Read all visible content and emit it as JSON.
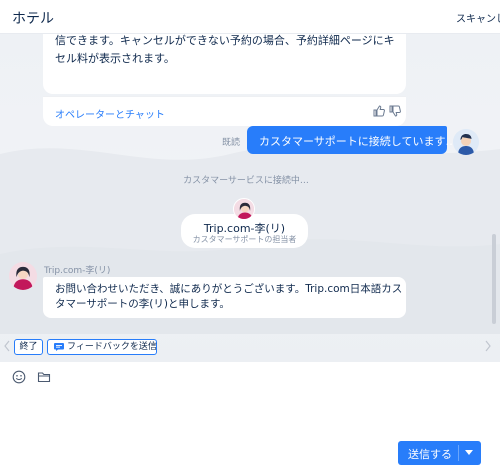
{
  "header": {
    "title": "ホテル",
    "right_text": "スキャンし"
  },
  "messages": {
    "previous": {
      "line1": "信できます。キャンセルができない予約の場合、予約詳細ページにキャン",
      "line2": "セル料が表示されます。",
      "operator_link": "オペレーターとチャット"
    },
    "user": {
      "read_label": "既読",
      "text": "カスタマーサポートに接続しています…"
    },
    "system": {
      "text": "カスタマーサービスに接続中…"
    },
    "agent_card": {
      "name": "Trip.com-李(リ)",
      "role": "カスタマーサポートの担当者"
    },
    "agent_reply": {
      "sender": "Trip.com-李(リ)",
      "line1": "お問い合わせいただき、誠にありがとうございます。Trip.com日本語カス",
      "line2": "タマーサポートの李(リ)と申します。"
    }
  },
  "actions": {
    "end_label": "終了",
    "feedback_label": "フィードバックを送信"
  },
  "composer": {
    "input_value": "",
    "input_placeholder": "",
    "send_label": "送信する"
  },
  "icons": {
    "like": "thumbs-up-icon",
    "dislike": "thumbs-down-icon",
    "emoji": "emoji-icon",
    "folder": "folder-icon",
    "feedback": "feedback-icon",
    "chevron_left": "chevron-left-icon",
    "chevron_right": "chevron-right-icon",
    "send_dropdown": "caret-down-icon"
  },
  "colors": {
    "accent": "#287dfa",
    "text": "#0f294d",
    "muted": "#8592a6",
    "chat_bg": "#eef1f5"
  }
}
